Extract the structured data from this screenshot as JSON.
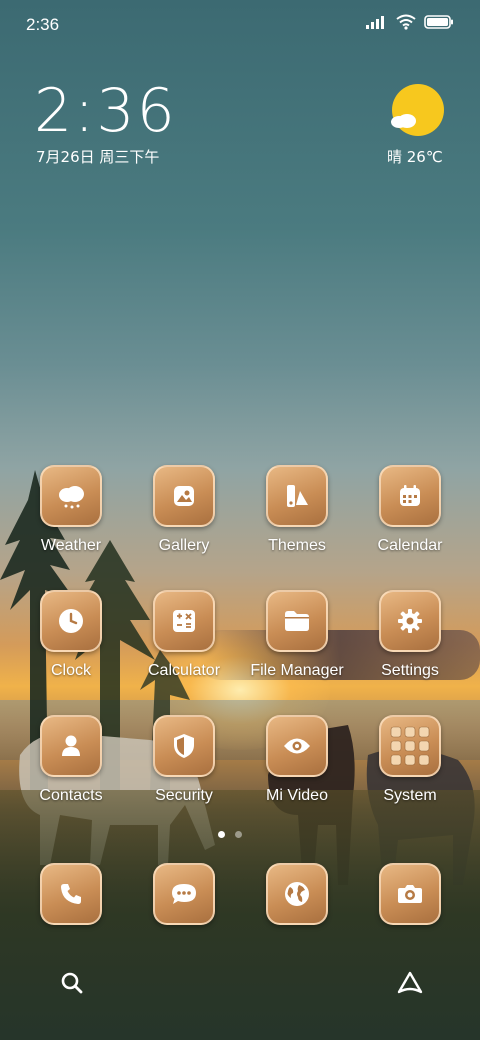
{
  "status_bar": {
    "time": "2:36"
  },
  "clock": {
    "time": "2:36",
    "date": "7月26日 周三下午"
  },
  "weather": {
    "text": "晴 26℃"
  },
  "apps": [
    {
      "label": "Weather",
      "icon": "cloud-icon"
    },
    {
      "label": "Gallery",
      "icon": "image-icon"
    },
    {
      "label": "Themes",
      "icon": "palette-icon"
    },
    {
      "label": "Calendar",
      "icon": "calendar-icon"
    },
    {
      "label": "Clock",
      "icon": "clock-icon"
    },
    {
      "label": "Calculator",
      "icon": "calculator-icon"
    },
    {
      "label": "File Manager",
      "icon": "folder-icon"
    },
    {
      "label": "Settings",
      "icon": "gear-icon"
    },
    {
      "label": "Contacts",
      "icon": "person-icon"
    },
    {
      "label": "Security",
      "icon": "shield-icon"
    },
    {
      "label": "Mi Video",
      "icon": "eye-icon"
    },
    {
      "label": "System",
      "icon": "app-folder-icon"
    }
  ],
  "dock": [
    {
      "icon": "phone-icon"
    },
    {
      "icon": "message-icon"
    },
    {
      "icon": "globe-icon"
    },
    {
      "icon": "camera-icon"
    }
  ],
  "page_indicator": {
    "pages": 2,
    "current": 1
  },
  "bottom_bar": [
    {
      "icon": "search-icon"
    },
    {
      "icon": "assistant-icon"
    }
  ],
  "colors": {
    "tile_gradient": [
      "#e8b884",
      "#a9703f"
    ],
    "sun": "#f7c81e"
  }
}
